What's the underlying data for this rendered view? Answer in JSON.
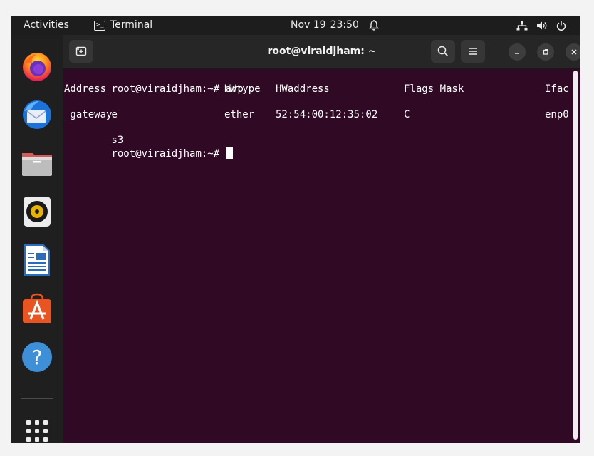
{
  "topbar": {
    "activities": "Activities",
    "app_name": "Terminal",
    "date": "Nov 19",
    "time": "23:50"
  },
  "dock": {
    "items": [
      {
        "name": "Firefox"
      },
      {
        "name": "Thunderbird Mail"
      },
      {
        "name": "Files"
      },
      {
        "name": "Rhythmbox"
      },
      {
        "name": "LibreOffice Writer"
      },
      {
        "name": "Ubuntu Software"
      },
      {
        "name": "Help"
      },
      {
        "name": "Show Applications"
      }
    ]
  },
  "terminal": {
    "title": "root@viraidjham: ~",
    "prompt": "root@viraidjham:~#",
    "command": "arp",
    "headers": {
      "address": "Address",
      "hwtype": "HWtype",
      "hwaddress": "HWaddress",
      "flags_mask": "Flags Mask",
      "iface": "Ifac",
      "iface_wrap": "e"
    },
    "row": {
      "address": "_gateway",
      "hwtype": "ether",
      "hwaddress": "52:54:00:12:35:02",
      "flags": "C",
      "iface": "enp0",
      "iface_wrap": "s3"
    }
  },
  "colors": {
    "terminal_bg": "#300a24",
    "topbar_bg": "#1d1d1d",
    "dock_bg": "#1f1f1f"
  }
}
